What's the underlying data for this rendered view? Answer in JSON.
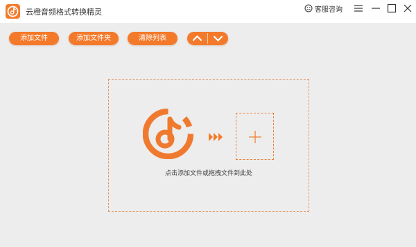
{
  "app": {
    "title": "云橙音频格式转换精灵",
    "logo_icon": "app-logo-icon"
  },
  "header": {
    "support_label": "客服咨询",
    "support_icon": "smiley-icon",
    "window_controls": [
      "menu-icon",
      "minimize-icon",
      "maximize-icon",
      "close-icon"
    ]
  },
  "toolbar": {
    "add_file_label": "添加文件",
    "add_folder_label": "添加文件夹",
    "clear_list_label": "清除列表",
    "move_up_icon": "chevron-up-icon",
    "move_down_icon": "chevron-down-icon"
  },
  "main": {
    "drop_hint": "点击添加文件或拖拽文件到此处",
    "center_icon": "music-note-icon",
    "arrow_icon": "triple-chevron-right-icon",
    "add_icon": "plus-icon"
  },
  "colors": {
    "accent": "#f47a2b",
    "background": "#ededed",
    "titlebar": "#ffffff"
  }
}
